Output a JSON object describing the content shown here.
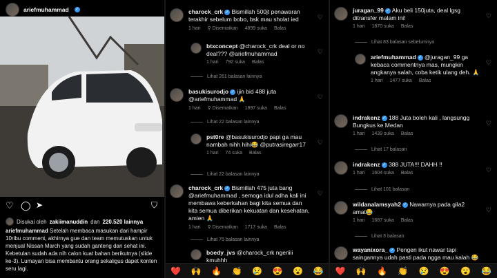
{
  "panel1": {
    "username": "ariefmuhammad",
    "likes_prefix": "Disukai oleh",
    "likes_user": "zakiimanuddin",
    "likes_mid": "dan",
    "likes_count": "220.520 lainnya",
    "caption_user": "ariefmuhammad",
    "caption": "Setelah membaca masukan dari hampir 10ribu comment, akhirnya gue dan team memutuskan untuk menjual Nissan March yang sudah ganteng dan sehat ini. Kebetulan sudah ada nih calon kuat bahan berikutnya (slide ke-3). Lumayan bisa membantu orang sekaligus dapet konten seru lagi.",
    "photo_alt": "White Nissan March car parked"
  },
  "panel2": {
    "comments": [
      {
        "user": "charock_crk",
        "text": "Bismillah 500jt penawaran terakhir sebelum bobo, bsk mau sholat ied",
        "time": "1 hari",
        "pinned": "Disematkan",
        "likes": "4899 suka",
        "reply": "Balas"
      },
      {
        "user": "btxconcept",
        "text": "@charock_crk deal or no deal??? @ariefmuhammad",
        "time": "1 hari",
        "likes": "792 suka",
        "reply": "Balas"
      },
      {
        "user": "basukisurodjo",
        "text": "ijin bid 488 juta @ariefmuhammad 🙏",
        "time": "1 hari",
        "pinned": "Disematkan",
        "likes": "1897 suka",
        "reply": "Balas"
      },
      {
        "user": "pst0re",
        "text": "@basukisurodjo papi ga mau nambah nihh hihi😂 @putrasiregarr17",
        "time": "1 hari",
        "likes": "74 suka",
        "reply": "Balas"
      },
      {
        "user": "charock_crk",
        "text": "Bismillah 475 juta bang @ariefmuhammad , semoga idul adha kali ini membawa keberkahan bagi kita semua dan kita semua diberikan kekuatan dan kesehatan, amien 🙏",
        "time": "1 hari",
        "pinned": "Disematkan",
        "likes": "1717 suka",
        "reply": "Balas"
      },
      {
        "user": "boedy_jvs",
        "text": "@charock_crk ngeriiii kmuhhh",
        "time": "",
        "likes": "",
        "reply": ""
      }
    ],
    "view_more": [
      "Lihat 261 balasan lainnya",
      "Lihat 22 balasan lainnya",
      "Lihat 75 balasan lainnya"
    ],
    "reply_others": "Lihat 22 balasan lainnya"
  },
  "panel3": {
    "comments": [
      {
        "user": "juragan_99",
        "text": "Aku beli 150juta, deal lgsg ditransfer malam ini!",
        "time": "1 hari",
        "likes": "1870 suka",
        "reply": "Balas"
      },
      {
        "user": "ariefmuhammad",
        "text": "@juragan_99 ga kebaca commentnya mas, mungkin angkanya salah, coba ketik ulang deh. 🙏",
        "time": "1 hari",
        "likes": "1477 suka",
        "reply": "Balas"
      },
      {
        "user": "indrakenz",
        "text": "188 Juta boleh kali , langsungg Bungkus ke Medan",
        "time": "1 hari",
        "likes": "1439 suka",
        "reply": "Balas"
      },
      {
        "user": "indrakenz",
        "text": "388 JUTA!!! DAHH !!",
        "time": "1 hari",
        "likes": "1604 suka",
        "reply": "Balas"
      },
      {
        "user": "wildanalamsyah2",
        "text": "Nawarnya pada gila2 amat😂",
        "time": "1 hari",
        "likes": "1687 suka",
        "reply": "Balas"
      },
      {
        "user": "wayanixora_",
        "text": "Pengen ikut nawar tapi saingannya udah pasti pada ngga mau kalah 😂",
        "time": "",
        "likes": "",
        "reply": ""
      }
    ],
    "view_more": [
      "Lihat 83 balasan sebelumnya",
      "Lihat 17 balasan",
      "Lihat 101 balasan",
      "Lihat 3 balasan"
    ]
  },
  "emoji_bar": [
    "❤️",
    "🙌",
    "🔥",
    "👏",
    "😢",
    "😍",
    "😮",
    "😂"
  ],
  "colors": {
    "accent": "#3897f0",
    "muted": "#8e8e8e"
  }
}
